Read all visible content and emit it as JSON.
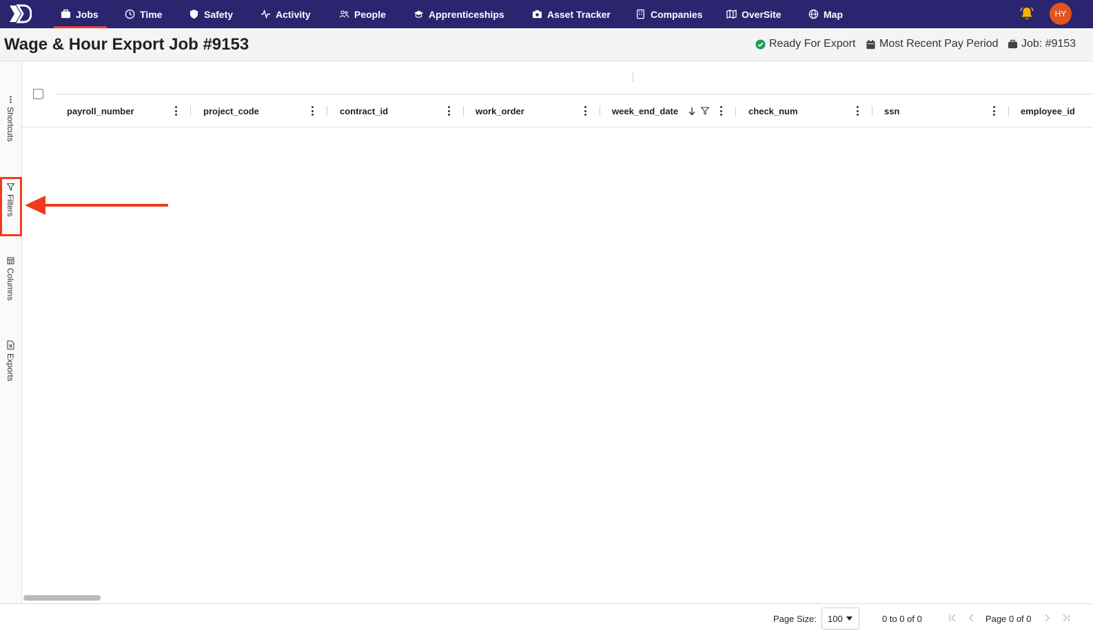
{
  "nav": {
    "items": [
      {
        "label": "Jobs",
        "icon": "briefcase-icon"
      },
      {
        "label": "Time",
        "icon": "clock-icon"
      },
      {
        "label": "Safety",
        "icon": "shield-icon"
      },
      {
        "label": "Activity",
        "icon": "activity-icon"
      },
      {
        "label": "People",
        "icon": "people-icon"
      },
      {
        "label": "Apprenticeships",
        "icon": "graduation-cap-icon"
      },
      {
        "label": "Asset Tracker",
        "icon": "camera-icon"
      },
      {
        "label": "Companies",
        "icon": "building-icon"
      },
      {
        "label": "OverSite",
        "icon": "map-icon"
      },
      {
        "label": "Map",
        "icon": "globe-icon"
      }
    ],
    "active": "Jobs",
    "avatar_initials": "HY",
    "colors": {
      "bar": "#2b2570",
      "active_underline": "#e0413a",
      "bell": "#f5b400",
      "avatar": "#e0541e"
    }
  },
  "header": {
    "title": "Wage & Hour Export Job #9153",
    "status": "Ready For Export",
    "period": "Most Recent Pay Period",
    "job": "Job: #9153",
    "status_color": "#1f9d55"
  },
  "sidebar": {
    "shortcuts": "Shortcuts",
    "filters": "Filters",
    "columns": "Columns",
    "exports": "Exports",
    "highlight_color": "#f23a1c"
  },
  "grid": {
    "columns": [
      "payroll_number",
      "project_code",
      "contract_id",
      "work_order",
      "week_end_date",
      "check_num",
      "ssn",
      "employee_id"
    ],
    "sorted_column": "week_end_date"
  },
  "footer": {
    "page_size_label": "Page Size:",
    "page_size_value": "100",
    "range": "0 to 0 of 0",
    "page": "Page 0 of 0"
  }
}
